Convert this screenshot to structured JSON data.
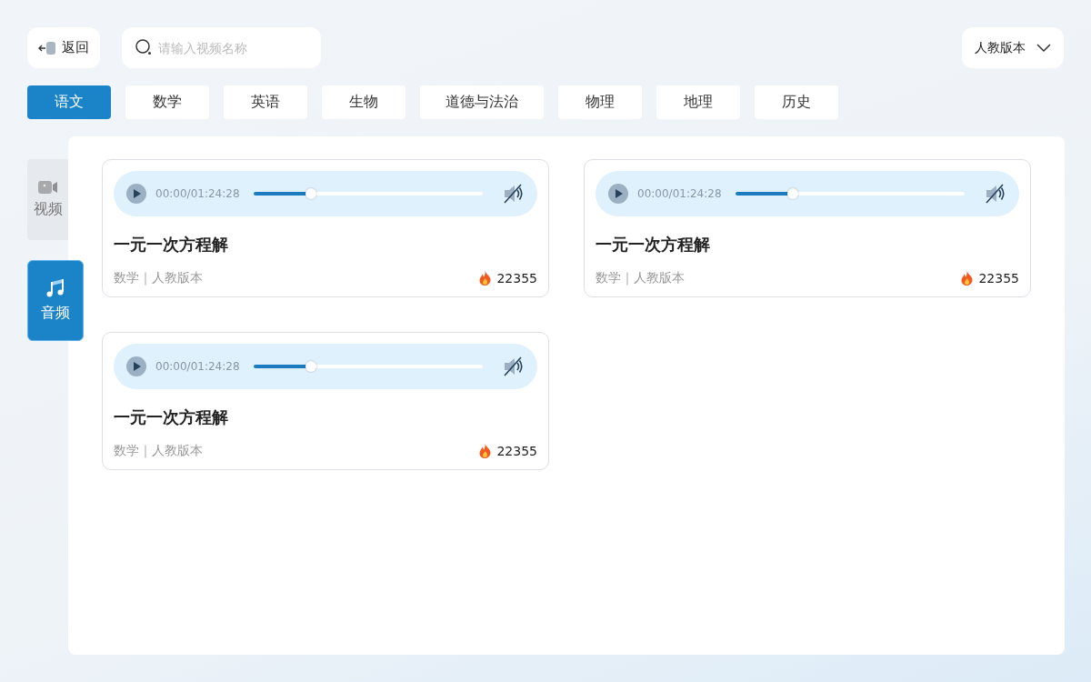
{
  "back_button": {
    "label": "返回"
  },
  "search": {
    "placeholder": "请输入视频名称"
  },
  "edition_select": {
    "value": "人教版本"
  },
  "subject_tabs": [
    {
      "label": "语文",
      "selected": true
    },
    {
      "label": "数学",
      "selected": false
    },
    {
      "label": "英语",
      "selected": false
    },
    {
      "label": "生物",
      "selected": false
    },
    {
      "label": "道德与法治",
      "selected": false
    },
    {
      "label": "物理",
      "selected": false
    },
    {
      "label": "地理",
      "selected": false
    },
    {
      "label": "历史",
      "selected": false
    }
  ],
  "media_tabs": [
    {
      "kind": "video",
      "label": "视频",
      "selected": false
    },
    {
      "kind": "audio",
      "label": "音频",
      "selected": true
    }
  ],
  "audio_items": [
    {
      "time": "00:00/01:24:28",
      "level": 0.25,
      "playing": false,
      "muted": true,
      "title": "一元一次方程解",
      "meta": "数学｜人教版本",
      "views": "22355"
    },
    {
      "time": "00:00/01:24:28",
      "level": 0.25,
      "playing": false,
      "muted": true,
      "title": "一元一次方程解",
      "meta": "数学｜人教版本",
      "views": "22355"
    },
    {
      "time": "00:00/01:24:28",
      "level": 0.25,
      "playing": false,
      "muted": true,
      "title": "一元一次方程解",
      "meta": "数学｜人教版本",
      "views": "22355"
    }
  ]
}
